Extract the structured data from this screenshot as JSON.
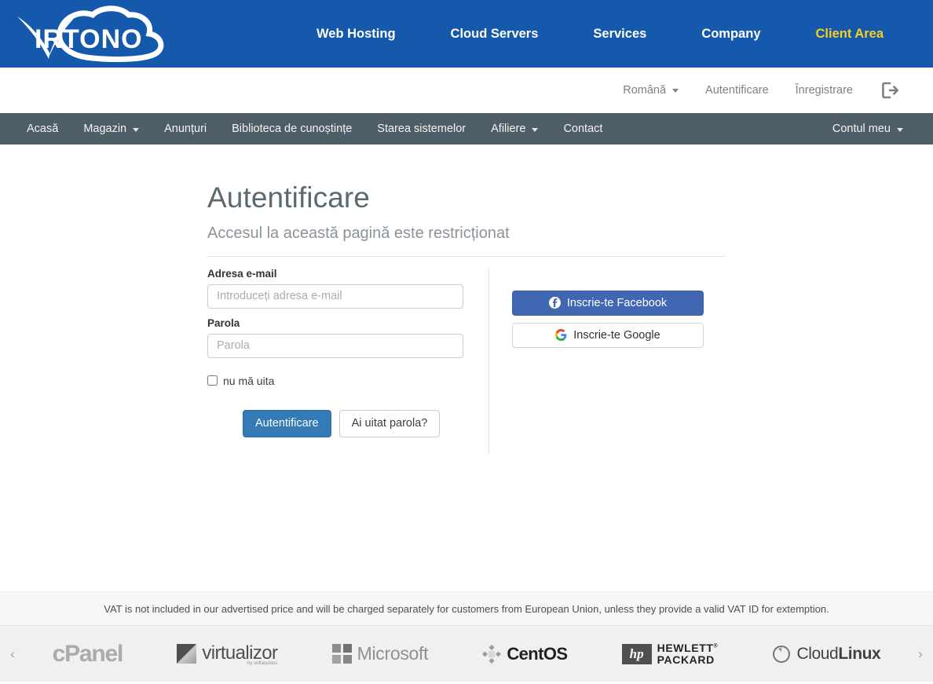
{
  "brand": {
    "logo_text": "VIRTONO",
    "logo_alt": "virtono-logo",
    "bar_color": "#1559ad"
  },
  "main_nav": [
    {
      "label": "Web Hosting",
      "accent": false
    },
    {
      "label": "Cloud Servers",
      "accent": false
    },
    {
      "label": "Services",
      "accent": false
    },
    {
      "label": "Company",
      "accent": false
    },
    {
      "label": "Client Area",
      "accent": true
    }
  ],
  "utility_bar": {
    "language": "Română",
    "login": "Autentificare",
    "register": "Înregistrare",
    "logout_icon": "sign-out-icon"
  },
  "client_nav": {
    "left_items": [
      {
        "label": "Acasă",
        "caret": false
      },
      {
        "label": "Magazin",
        "caret": true
      },
      {
        "label": "Anunțuri",
        "caret": false
      },
      {
        "label": "Biblioteca de cunoștințe",
        "caret": false
      },
      {
        "label": "Starea sistemelor",
        "caret": false
      },
      {
        "label": "Afiliere",
        "caret": true
      },
      {
        "label": "Contact",
        "caret": false
      }
    ],
    "right_item": {
      "label": "Contul meu",
      "caret": true
    },
    "bar_color": "#4f5e66"
  },
  "page": {
    "title": "Autentificare",
    "subtitle": "Accesul la această pagină este restricționat"
  },
  "form": {
    "email_label": "Adresa e-mail",
    "email_placeholder": "Introduceți adresa e-mail",
    "email_value": "",
    "password_label": "Parola",
    "password_placeholder": "Parola",
    "password_value": "",
    "remember_label": "nu mă uita",
    "remember_checked": false,
    "submit_label": "Autentificare",
    "forgot_label": "Ai uitat parola?",
    "primary_color": "#337ab7"
  },
  "social": {
    "facebook_label": "Inscrie-te Facebook",
    "facebook_icon": "facebook-icon",
    "facebook_color": "#4267b2",
    "google_label": "Inscrie-te Google",
    "google_icon": "google-icon"
  },
  "vat_notice": "VAT is not included in our advertised price and will be charged separately for customers from European Union, unless they provide a valid VAT ID for extemption.",
  "carousel": {
    "prev_icon": "‹",
    "next_icon": "›",
    "logos": [
      {
        "name": "cPanel"
      },
      {
        "name": "virtualizor",
        "sub": "by softaculous"
      },
      {
        "name": "Microsoft"
      },
      {
        "name": "CentOS"
      },
      {
        "name": "HEWLETT PACKARD",
        "line1": "HEWLETT",
        "line2": "PACKARD",
        "mark": "hp"
      },
      {
        "name": "CloudLinux",
        "part1": "Cloud",
        "part2": "Linux"
      }
    ]
  }
}
